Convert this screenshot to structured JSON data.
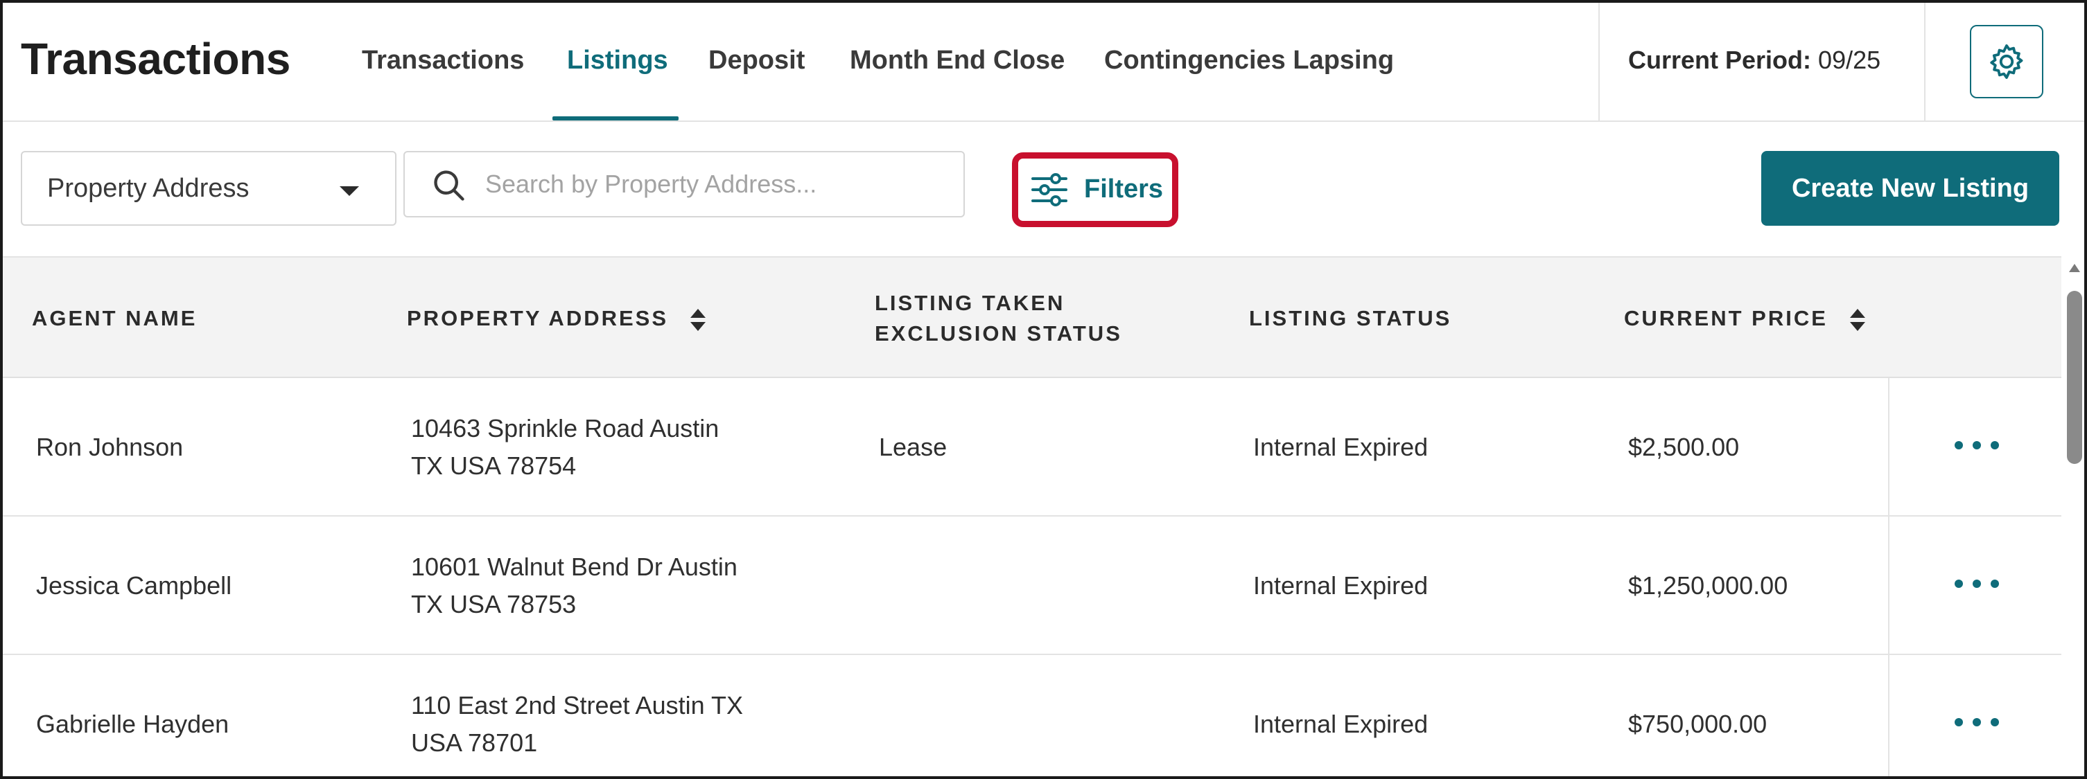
{
  "header": {
    "title": "Transactions",
    "tabs": [
      {
        "label": "Transactions",
        "active": false
      },
      {
        "label": "Listings",
        "active": true
      },
      {
        "label": "Deposit",
        "active": false
      },
      {
        "label": "Month End Close",
        "active": false
      },
      {
        "label": "Contingencies Lapsing",
        "active": false
      }
    ],
    "period_label": "Current Period:",
    "period_value": "09/25",
    "settings_icon": "gear-icon"
  },
  "toolbar": {
    "search_field_select": "Property Address",
    "search_placeholder": "Search by Property Address...",
    "filters_label": "Filters",
    "create_label": "Create New Listing"
  },
  "table": {
    "columns": [
      {
        "label": "AGENT NAME",
        "sortable": false
      },
      {
        "label": "PROPERTY ADDRESS",
        "sortable": true
      },
      {
        "label_line1": "LISTING TAKEN",
        "label_line2": "EXCLUSION STATUS",
        "sortable": false
      },
      {
        "label": "LISTING STATUS",
        "sortable": false
      },
      {
        "label": "CURRENT PRICE",
        "sortable": true
      }
    ],
    "rows": [
      {
        "agent": "Ron Johnson",
        "address_line1": "10463 Sprinkle Road Austin",
        "address_line2": "TX USA 78754",
        "exclusion_status": "Lease",
        "listing_status": "Internal Expired",
        "price": "$2,500.00"
      },
      {
        "agent": "Jessica Campbell",
        "address_line1": "10601 Walnut Bend Dr Austin",
        "address_line2": "TX USA 78753",
        "exclusion_status": "",
        "listing_status": "Internal Expired",
        "price": "$1,250,000.00"
      },
      {
        "agent": "Gabrielle Hayden",
        "address_line1": "110 East 2nd Street Austin TX",
        "address_line2": "USA 78701",
        "exclusion_status": "",
        "listing_status": "Internal Expired",
        "price": "$750,000.00"
      }
    ]
  },
  "colors": {
    "accent": "#0f6c7a",
    "highlight": "#c8102e"
  }
}
